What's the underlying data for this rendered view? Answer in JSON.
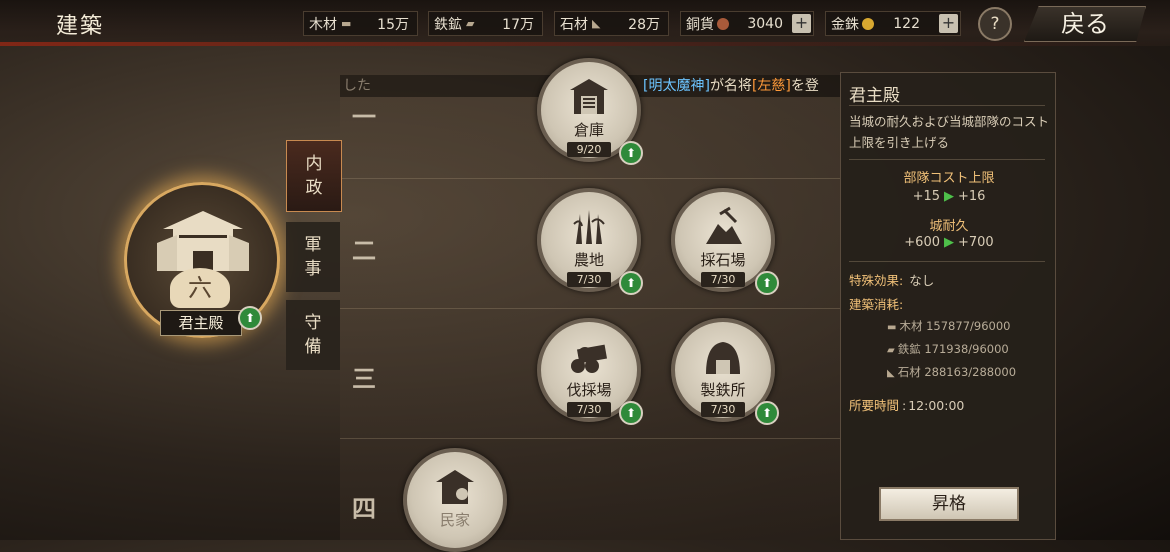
{
  "header": {
    "title": "建築",
    "back_label": "戻る",
    "help_label": "?",
    "resources": [
      {
        "label": "木材",
        "icon": "wood-icon",
        "value": "15万"
      },
      {
        "label": "鉄鉱",
        "icon": "anvil-icon",
        "value": "17万"
      },
      {
        "label": "石材",
        "icon": "stone-icon",
        "value": "28万"
      },
      {
        "label": "銅貨",
        "icon": "copper-coin-icon",
        "value": "3040",
        "has_plus": true
      },
      {
        "label": "金銖",
        "icon": "gold-coin-icon",
        "value": "122",
        "has_plus": true
      }
    ]
  },
  "notice": {
    "leading": "した",
    "player": "[明太魔神]",
    "mid": "が名将",
    "general": "[左慈]",
    "trailing": "を登"
  },
  "tiers": [
    "一",
    "二",
    "三",
    "四"
  ],
  "buildings": [
    {
      "name": "倉庫",
      "level": "9/20",
      "icon": "warehouse-icon"
    },
    {
      "name": "農地",
      "level": "7/30",
      "icon": "farm-icon"
    },
    {
      "name": "採石場",
      "level": "7/30",
      "icon": "quarry-icon"
    },
    {
      "name": "伐採場",
      "level": "7/30",
      "icon": "lumber-icon"
    },
    {
      "name": "製鉄所",
      "level": "7/30",
      "icon": "ironworks-icon"
    },
    {
      "name": "民家",
      "level": "",
      "icon": "house-icon"
    }
  ],
  "main_building": {
    "name": "君主殿",
    "badge": "六"
  },
  "side_tabs": [
    {
      "label": "内\n政"
    },
    {
      "label": "軍\n事"
    },
    {
      "label": "守\n備"
    }
  ],
  "panel": {
    "title": "君主殿",
    "description": "当城の耐久および当城部隊のコスト上限を引き上げる",
    "stat1_name": "部隊コスト上限",
    "stat1_from": "+15",
    "stat1_to": "+16",
    "stat2_name": "城耐久",
    "stat2_from": "+600",
    "stat2_to": "+700",
    "special_label": "特殊効果:",
    "special_value": "なし",
    "cost_label": "建築消耗:",
    "costs": [
      {
        "name": "木材",
        "value": "157877/96000"
      },
      {
        "name": "鉄鉱",
        "value": "171938/96000"
      },
      {
        "name": "石材",
        "value": "288163/288000"
      }
    ],
    "time_label": "所要時間",
    "time_value": "12:00:00",
    "upgrade_label": "昇格"
  },
  "colors": {
    "accent_gold": "#f0c078",
    "upgrade_green": "#2f8a3a",
    "notice_blue": "#6cc4ff",
    "notice_orange": "#ff9a3a"
  }
}
